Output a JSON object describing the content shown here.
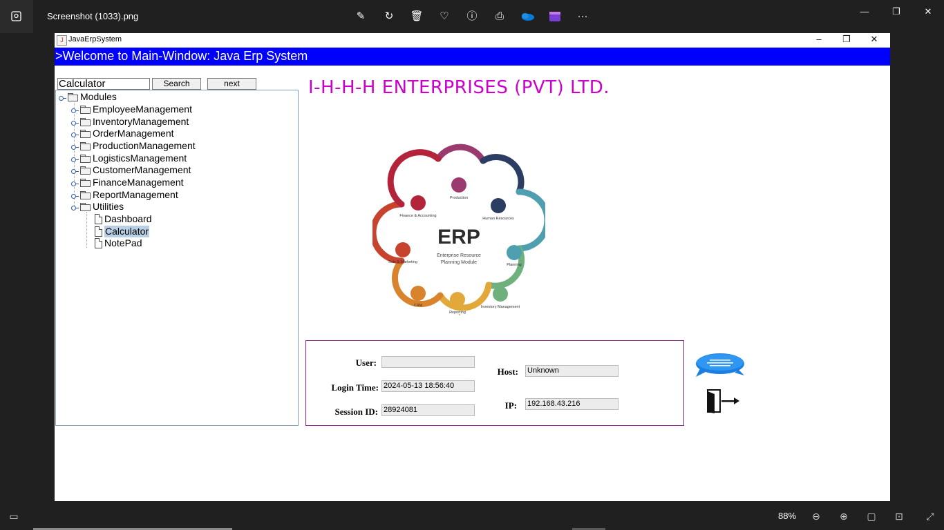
{
  "viewer": {
    "file_name": "Screenshot (1033).png",
    "zoom": "88%",
    "toolbar_icons": [
      "edit-image-icon",
      "rotate-icon",
      "delete-icon",
      "favorite-icon",
      "info-icon",
      "print-icon",
      "onedrive-icon",
      "clipchamp-icon",
      "more-icon"
    ],
    "window_controls": [
      "minimize-icon",
      "maximize-icon",
      "close-icon"
    ]
  },
  "app": {
    "window_title": "JavaErpSystem",
    "banner": ">Welcome to Main-Window: Java Erp System",
    "search": {
      "value": "Calculator",
      "search_label": "Search",
      "next_label": "next"
    },
    "company_name": "I-H-H-H ENTERPRISES (PVT) LTD.",
    "tree": {
      "root": "Modules",
      "modules": [
        "EmployeeManagement",
        "InventoryManagement",
        "OrderManagement",
        "ProductionManagement",
        "LogisticsManagement",
        "CustomerManagement",
        "FinanceManagement",
        "ReportManagement",
        "Utilities"
      ],
      "utilities_children": [
        "Dashboard",
        "Calculator",
        "NotePad"
      ],
      "selected": "Calculator"
    },
    "logo": {
      "center_title": "ERP",
      "center_subtitle_1": "Enterprise Resource",
      "center_subtitle_2": "Planning Module",
      "segments": [
        {
          "label": "Production",
          "color": "#9b3a6e"
        },
        {
          "label": "Human Resources",
          "color": "#2b3d63"
        },
        {
          "label": "Planning",
          "color": "#4f9fb1"
        },
        {
          "label": "Inventory Management",
          "color": "#6fb07d"
        },
        {
          "label": "Reporting",
          "color": "#e2a93a"
        },
        {
          "label": "CRM",
          "color": "#d9832c"
        },
        {
          "label": "Sale & Marketing",
          "color": "#c8432e"
        },
        {
          "label": "Finance & Accounting",
          "color": "#b3243a"
        }
      ]
    },
    "session": {
      "user_label": "User:",
      "user_value": "",
      "login_time_label": "Login Time:",
      "login_time_value": "2024-05-13 18:56:40",
      "session_id_label": "Session ID:",
      "session_id_value": "28924081",
      "host_label": "Host:",
      "host_value": "Unknown",
      "ip_label": "IP:",
      "ip_value": "192.168.43.216"
    }
  }
}
